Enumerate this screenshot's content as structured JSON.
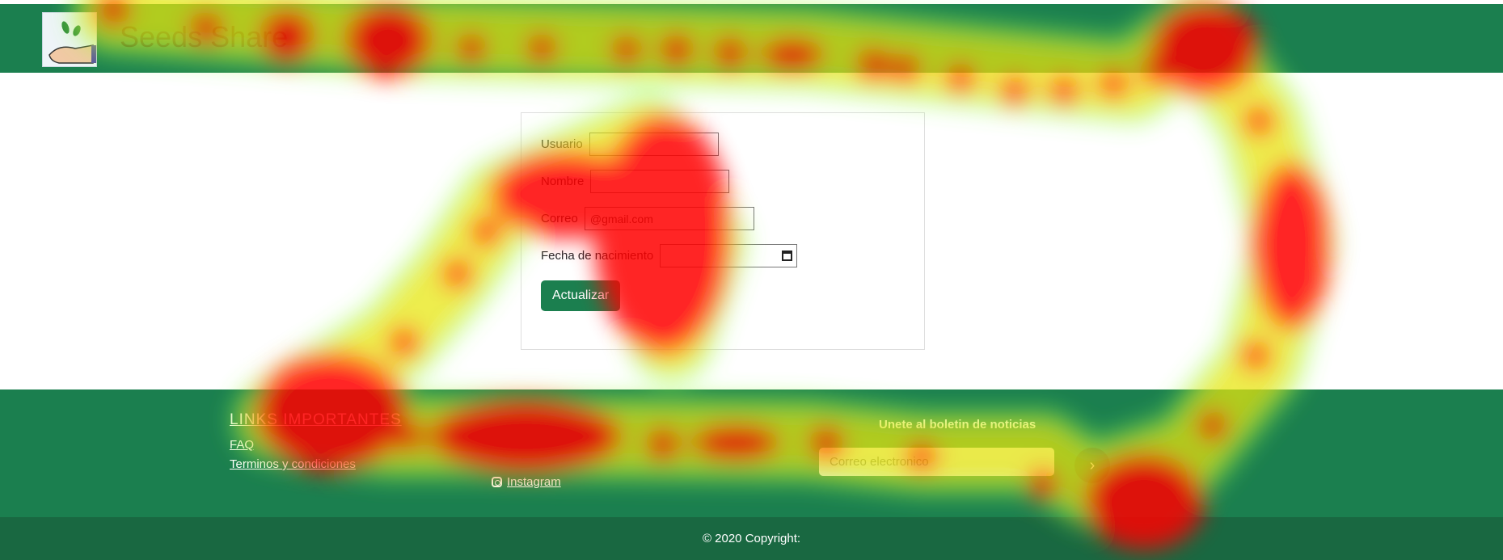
{
  "header": {
    "brand": "Seeds Share",
    "logo_icon": "hand-with-leaves-icon"
  },
  "form": {
    "usuario_label": "Usuario",
    "usuario_value": "",
    "nombre_label": "Nombre",
    "nombre_value": "",
    "correo_label": "Correo",
    "correo_value": "@gmail.com",
    "fecha_label": "Fecha de nacimiento",
    "fecha_value": "",
    "submit_label": "Actualizar"
  },
  "footer": {
    "links_title": "LINKS IMPORTANTES",
    "link_faq": "FAQ",
    "link_terms": "Terminos y condiciones",
    "social_label": "Instagram",
    "newsletter_title": "Unete al boletin de noticias",
    "newsletter_placeholder": "Correo electronico",
    "newsletter_button": "›"
  },
  "copyright": "© 2020 Copyright:",
  "colors": {
    "brand_green": "#1b7f4f",
    "copyright_green": "#196841"
  }
}
